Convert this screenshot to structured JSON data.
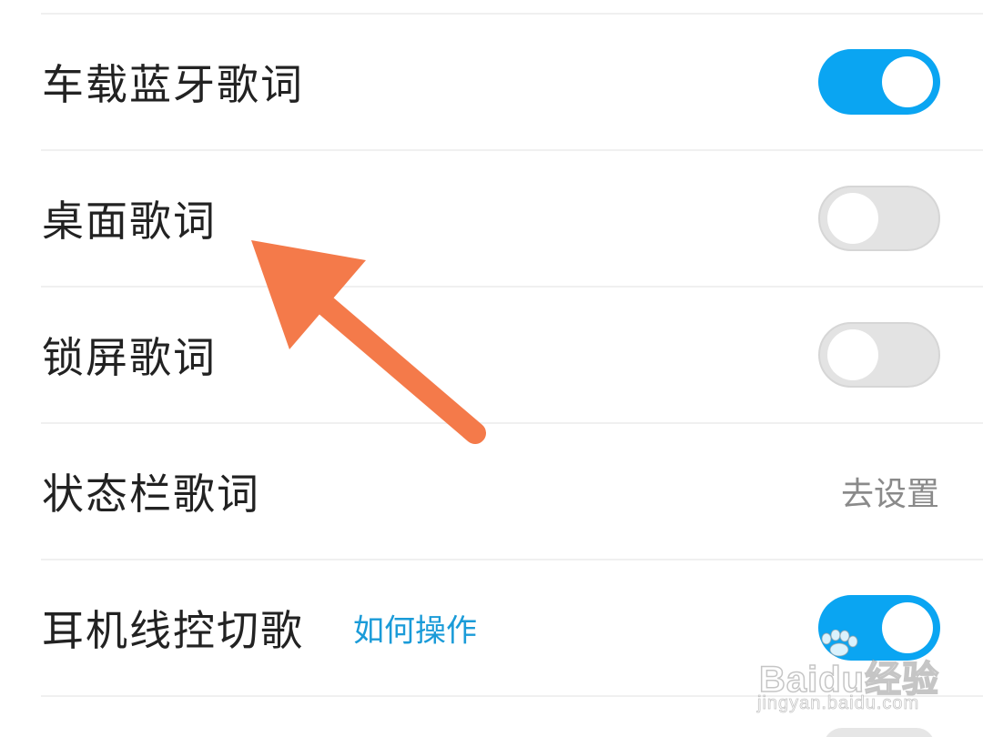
{
  "settings": {
    "items": [
      {
        "label": "车载蓝牙歌词",
        "control": "toggle",
        "state": "on"
      },
      {
        "label": "桌面歌词",
        "control": "toggle",
        "state": "off"
      },
      {
        "label": "锁屏歌词",
        "control": "toggle",
        "state": "off"
      },
      {
        "label": "状态栏歌词",
        "control": "link",
        "action_label": "去设置"
      },
      {
        "label": "耳机线控切歌",
        "help_link": "如何操作",
        "control": "toggle",
        "state": "on"
      }
    ]
  },
  "colors": {
    "toggle_on": "#0aa5f2",
    "toggle_off": "#e3e3e3",
    "help_link": "#1a9bd8",
    "annotation_arrow": "#f47a4a",
    "action_text": "#8a8a8a"
  },
  "watermark": {
    "brand": "Baidu经验",
    "url": "jingyan.baidu.com"
  }
}
